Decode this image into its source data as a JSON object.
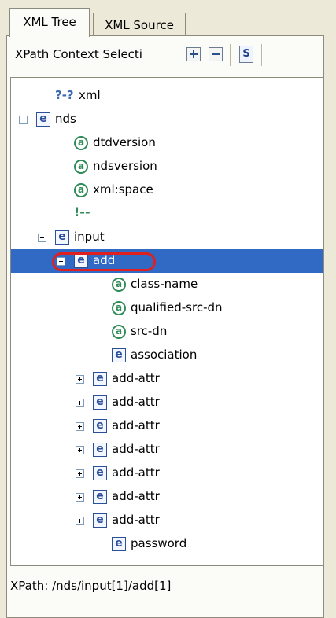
{
  "tabs": [
    {
      "label": "XML Tree",
      "active": true
    },
    {
      "label": "XML Source",
      "active": false
    }
  ],
  "toolbar": {
    "context_label": "XPath Context Selecti",
    "expand_icon": "expand-all-icon",
    "collapse_icon": "collapse-all-icon",
    "schema_icon": "schema-s-icon",
    "schema_letter": "S"
  },
  "tree": {
    "nodes": [
      {
        "label": "xml",
        "kind": "processing-instruction",
        "icon_text": "?-?",
        "toggle": null,
        "depth": 1
      },
      {
        "label": "nds",
        "kind": "element",
        "icon_text": "e",
        "toggle": "minus",
        "depth": 0
      },
      {
        "label": "dtdversion",
        "kind": "attribute",
        "icon_text": "a",
        "toggle": null,
        "depth": 2
      },
      {
        "label": "ndsversion",
        "kind": "attribute",
        "icon_text": "a",
        "toggle": null,
        "depth": 2
      },
      {
        "label": "xml:space",
        "kind": "attribute",
        "icon_text": "a",
        "toggle": null,
        "depth": 2
      },
      {
        "label": "",
        "kind": "comment",
        "icon_text": "!--",
        "toggle": null,
        "depth": 2
      },
      {
        "label": "input",
        "kind": "element",
        "icon_text": "e",
        "toggle": "minus",
        "depth": 1
      },
      {
        "label": "add",
        "kind": "element",
        "icon_text": "e",
        "toggle": "minus",
        "depth": 2,
        "selected": true
      },
      {
        "label": "class-name",
        "kind": "attribute",
        "icon_text": "a",
        "toggle": null,
        "depth": 4
      },
      {
        "label": "qualified-src-dn",
        "kind": "attribute",
        "icon_text": "a",
        "toggle": null,
        "depth": 4
      },
      {
        "label": "src-dn",
        "kind": "attribute",
        "icon_text": "a",
        "toggle": null,
        "depth": 4
      },
      {
        "label": "association",
        "kind": "element",
        "icon_text": "e",
        "toggle": null,
        "depth": 4
      },
      {
        "label": "add-attr",
        "kind": "element",
        "icon_text": "e",
        "toggle": "plus",
        "depth": 3
      },
      {
        "label": "add-attr",
        "kind": "element",
        "icon_text": "e",
        "toggle": "plus",
        "depth": 3
      },
      {
        "label": "add-attr",
        "kind": "element",
        "icon_text": "e",
        "toggle": "plus",
        "depth": 3
      },
      {
        "label": "add-attr",
        "kind": "element",
        "icon_text": "e",
        "toggle": "plus",
        "depth": 3
      },
      {
        "label": "add-attr",
        "kind": "element",
        "icon_text": "e",
        "toggle": "plus",
        "depth": 3
      },
      {
        "label": "add-attr",
        "kind": "element",
        "icon_text": "e",
        "toggle": "plus",
        "depth": 3
      },
      {
        "label": "add-attr",
        "kind": "element",
        "icon_text": "e",
        "toggle": "plus",
        "depth": 3
      },
      {
        "label": "password",
        "kind": "element",
        "icon_text": "e",
        "toggle": null,
        "depth": 4
      }
    ]
  },
  "status": {
    "xpath": "XPath:  /nds/input[1]/add[1]"
  },
  "colors": {
    "selection": "#316ac5",
    "highlight_ring": "#e01f1f",
    "element_icon": "#2c4f9a",
    "attribute_icon": "#2e8b57"
  }
}
